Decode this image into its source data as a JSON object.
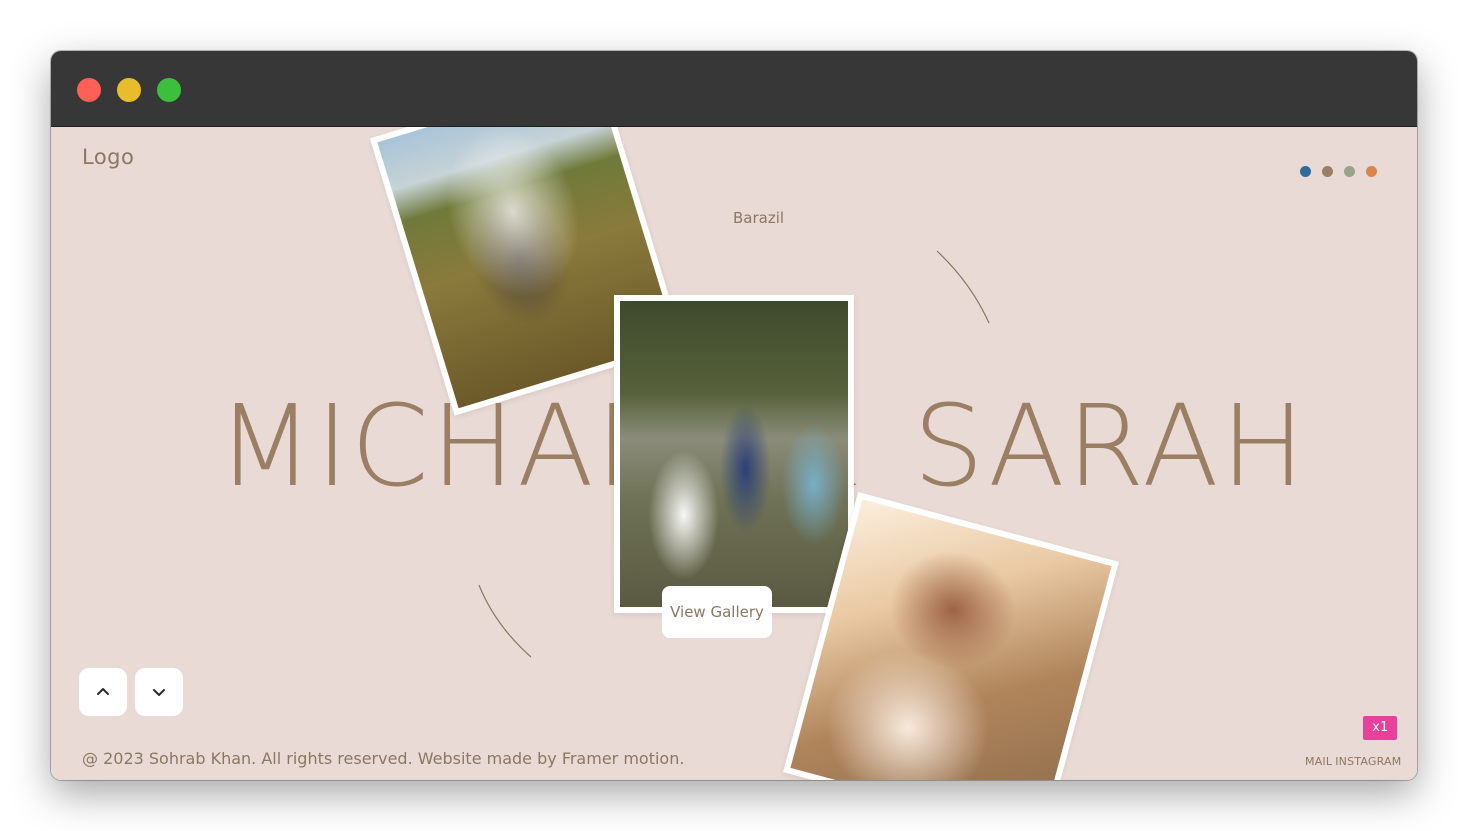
{
  "window": {
    "title": ""
  },
  "header": {
    "logo": "Logo",
    "location": "Barazil",
    "color_swatches": [
      "#2f6c9c",
      "#9a7f64",
      "#97a48a",
      "#d9854d"
    ]
  },
  "hero": {
    "name_left": "MICHAEL",
    "ampersand": "&",
    "name_right": "SARAH",
    "gallery_button": "View Gallery"
  },
  "photos": [
    {
      "description_icon": "couple-veil-field-photo"
    },
    {
      "description_icon": "wedding-kiss-bridesmaids-photo"
    },
    {
      "description_icon": "couple-sunset-veil-photo"
    }
  ],
  "nav": {
    "up_icon": "chevron-up-icon",
    "down_icon": "chevron-down-icon"
  },
  "footer": {
    "copyright": "@ 2023 Sohrab Khan. All rights reserved. Website made by Framer motion.",
    "links": [
      "MAIL",
      "INSTAGRAM"
    ]
  },
  "badge": {
    "label": "x1",
    "color": "#e8419b"
  },
  "colors": {
    "background": "#e9dad5",
    "accent": "#9a7f64",
    "titlebar": "#373737"
  }
}
